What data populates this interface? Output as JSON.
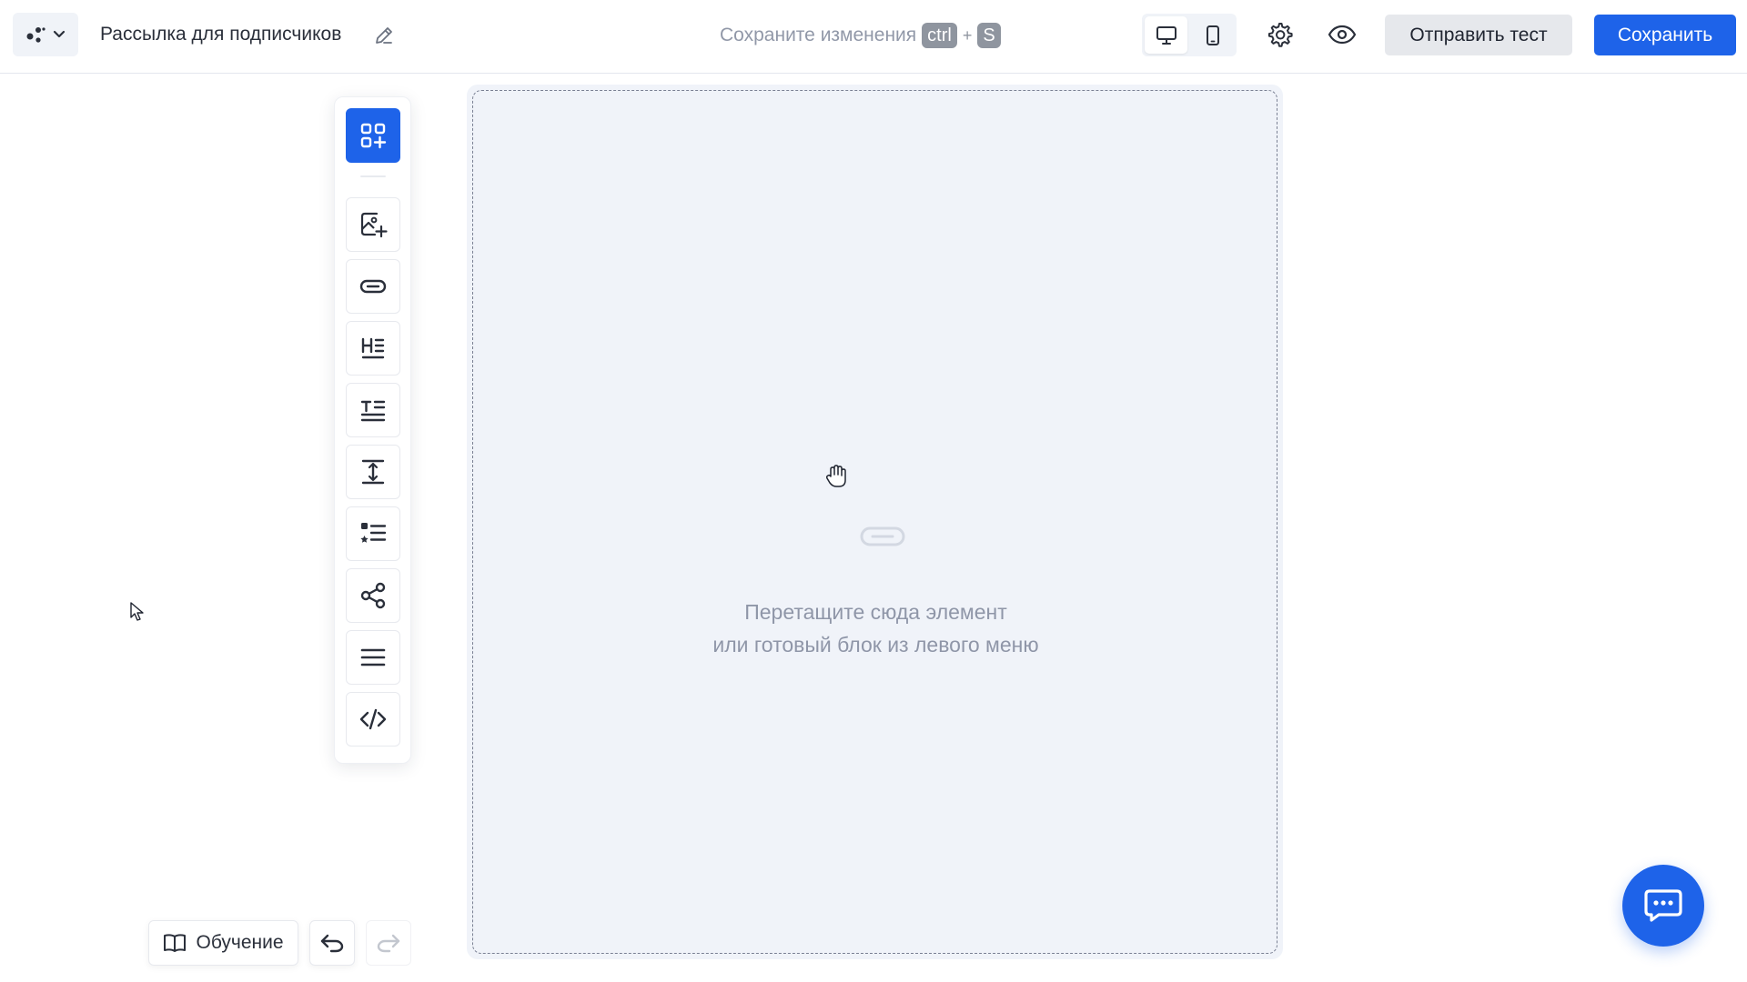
{
  "header": {
    "document_title": "Рассылка для подписчиков",
    "save_hint": {
      "text": "Сохраните изменения",
      "key_modifier": "ctrl",
      "key_plus": "+",
      "key_letter": "S"
    },
    "send_test_label": "Отправить тест",
    "save_label": "Сохранить",
    "device_mode": "desktop"
  },
  "toolbar": {
    "items": [
      {
        "icon": "add-blocks-icon"
      },
      {
        "icon": "image-add-icon"
      },
      {
        "icon": "button-icon"
      },
      {
        "icon": "heading-icon"
      },
      {
        "icon": "text-icon"
      },
      {
        "icon": "spacer-icon"
      },
      {
        "icon": "list-icon"
      },
      {
        "icon": "social-share-icon"
      },
      {
        "icon": "divider-icon"
      },
      {
        "icon": "code-icon"
      }
    ]
  },
  "canvas": {
    "empty_line1": "Перетащите сюда элемент",
    "empty_line2": "или готовый блок из левого меню"
  },
  "bottom": {
    "learn_label": "Обучение"
  },
  "colors": {
    "accent": "#1e63e9",
    "canvas_bg": "#f0f3f9"
  }
}
